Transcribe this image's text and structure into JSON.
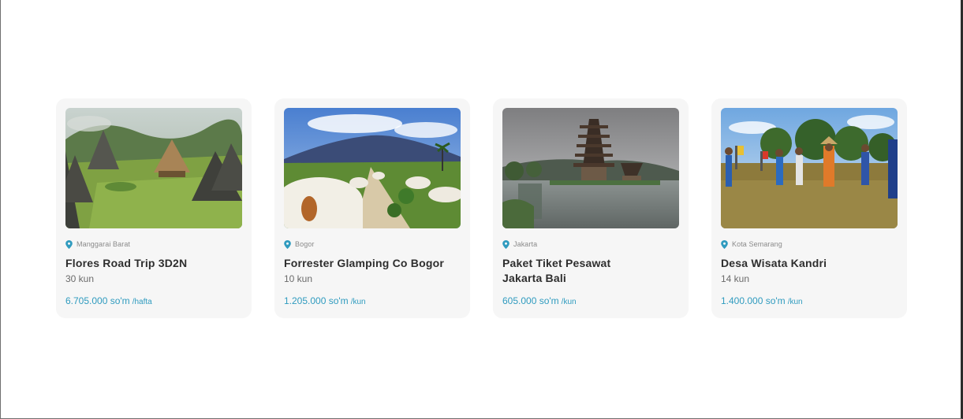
{
  "cards": [
    {
      "location": "Manggarai Barat",
      "title": "Flores Road Trip 3D2N",
      "duration": "30 kun",
      "price": "6.705.000 so'm",
      "unit": "/hafta",
      "image": "traditional-huts-village"
    },
    {
      "location": "Bogor",
      "title": "Forrester Glamping Co Bogor",
      "duration": "10 kun",
      "price": "1.205.000 so'm",
      "unit": "/kun",
      "image": "glamping-tents-mountain"
    },
    {
      "location": "Jakarta",
      "title": "Paket Tiket Pesawat Jakarta Bali",
      "duration": "",
      "price": "605.000 so'm",
      "unit": "/kun",
      "image": "bali-lake-temple"
    },
    {
      "location": "Kota Semarang",
      "title": "Desa Wisata Kandri",
      "duration": "14 kun",
      "price": "1.400.000 so'm",
      "unit": "/kun",
      "image": "village-dance-festival"
    }
  ],
  "colors": {
    "accent": "#2f9bbf",
    "card_bg": "#f6f6f6",
    "title": "#2e2e2e",
    "muted": "#8a8a8a"
  }
}
